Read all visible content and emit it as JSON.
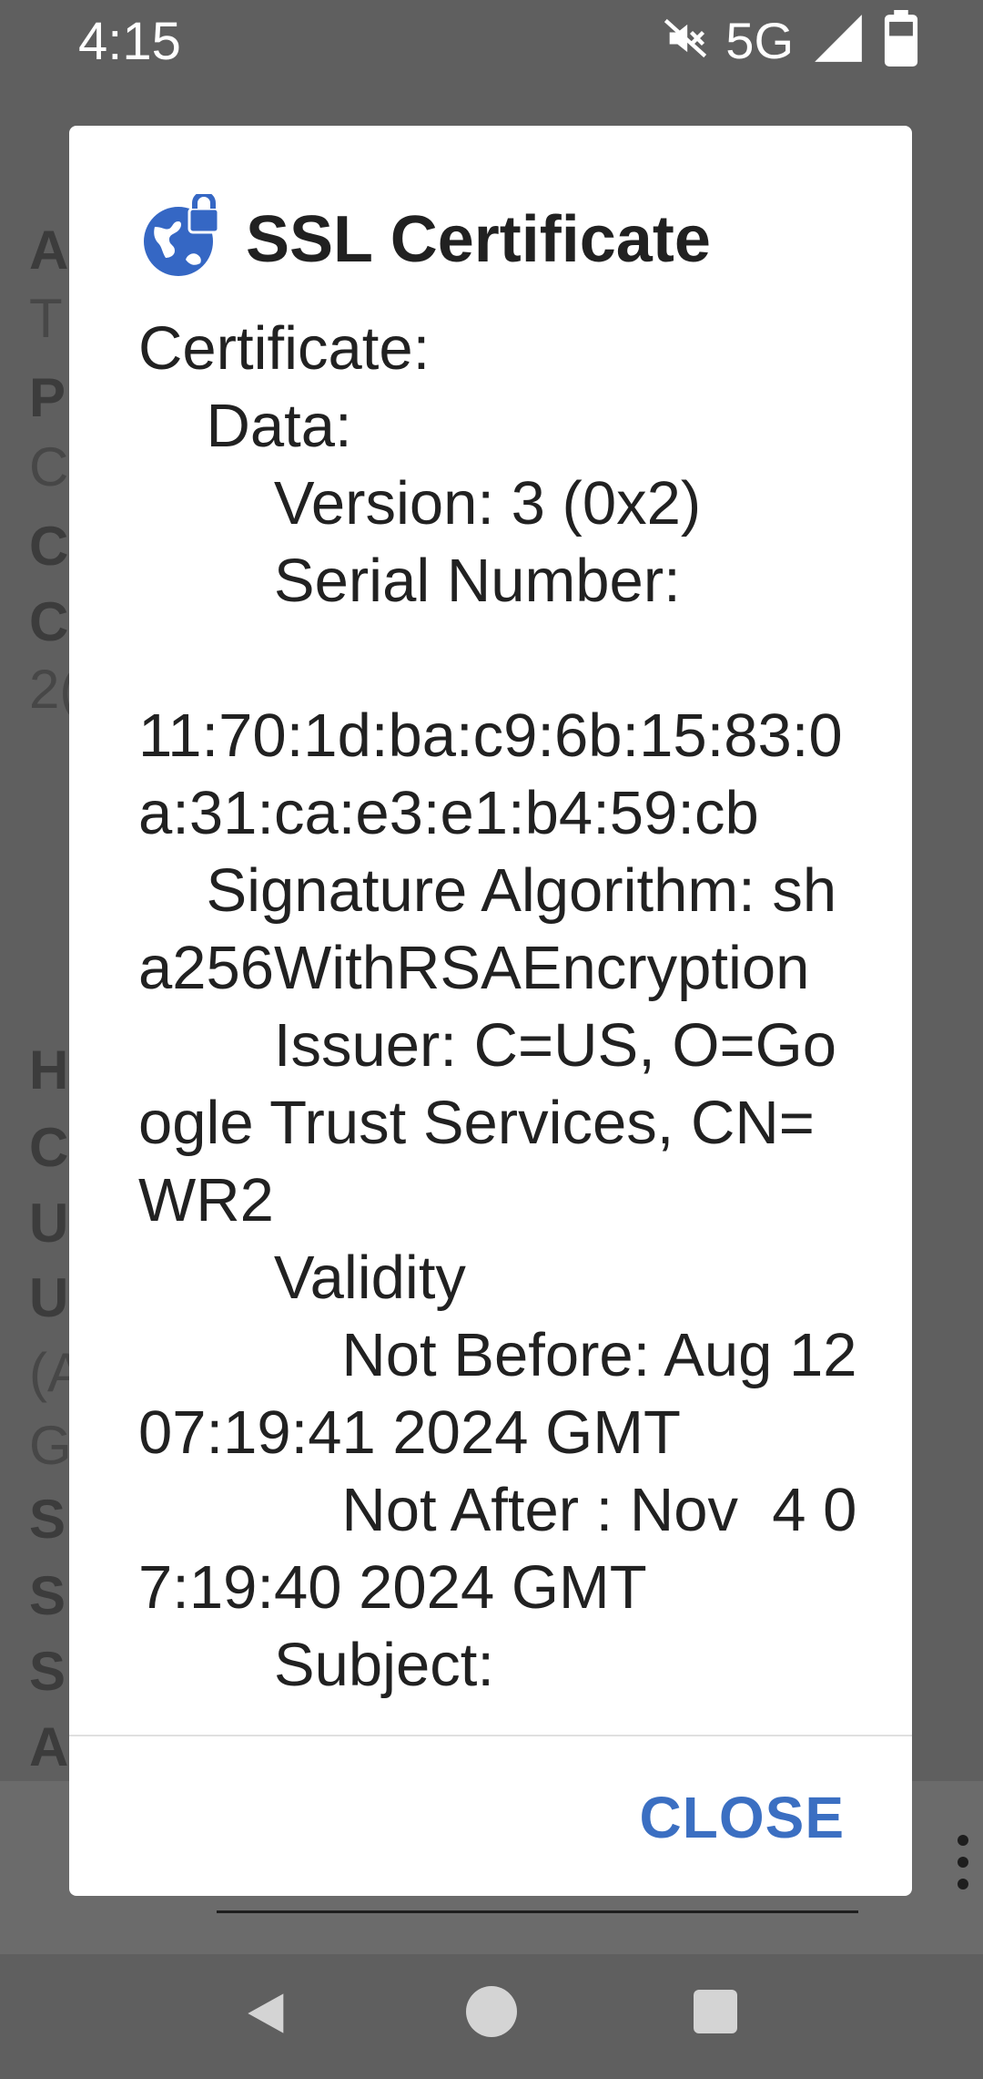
{
  "status_bar": {
    "time": "4:15",
    "network": "5G",
    "icons": [
      "mute-icon",
      "signal-icon",
      "battery-icon"
    ]
  },
  "background_page": {
    "letters": [
      {
        "text": "A",
        "bold": true
      },
      {
        "text": "T",
        "bold": false
      },
      {
        "text": "P",
        "bold": true
      },
      {
        "text": "C",
        "bold": false
      },
      {
        "text": "C",
        "bold": true
      },
      {
        "text": "C",
        "bold": true
      },
      {
        "text": "2(",
        "bold": false
      },
      {
        "text": "H",
        "bold": true
      },
      {
        "text": "C",
        "bold": true
      },
      {
        "text": "U",
        "bold": true
      },
      {
        "text": "U",
        "bold": true
      },
      {
        "text": "(A",
        "bold": false
      },
      {
        "text": "G",
        "bold": false
      },
      {
        "text": "S",
        "bold": true
      },
      {
        "text": "S",
        "bold": true
      },
      {
        "text": "S",
        "bold": true
      },
      {
        "text": "A",
        "bold": true
      }
    ]
  },
  "dialog": {
    "title": "SSL Certificate",
    "icon": "globe-lock-icon",
    "body_text": "Certificate:\n    Data:\n        Version: 3 (0x2)\n        Serial Number:\n\n11:70:1d:ba:c9:6b:15:83:0a:31:ca:e3:e1:b4:59:cb\n    Signature Algorithm: sha256WithRSAEncryption\n        Issuer: C=US, O=Google Trust Services, CN=WR2\n        Validity\n            Not Before: Aug 12 07:19:41 2024 GMT\n            Not After : Nov  4 07:19:40 2024 GMT\n        Subject:",
    "close_label": "CLOSE"
  },
  "colors": {
    "scrim": "#5f5f5f",
    "dialog_bg": "#ffffff",
    "accent": "#3b6fc2",
    "text": "#212121"
  }
}
